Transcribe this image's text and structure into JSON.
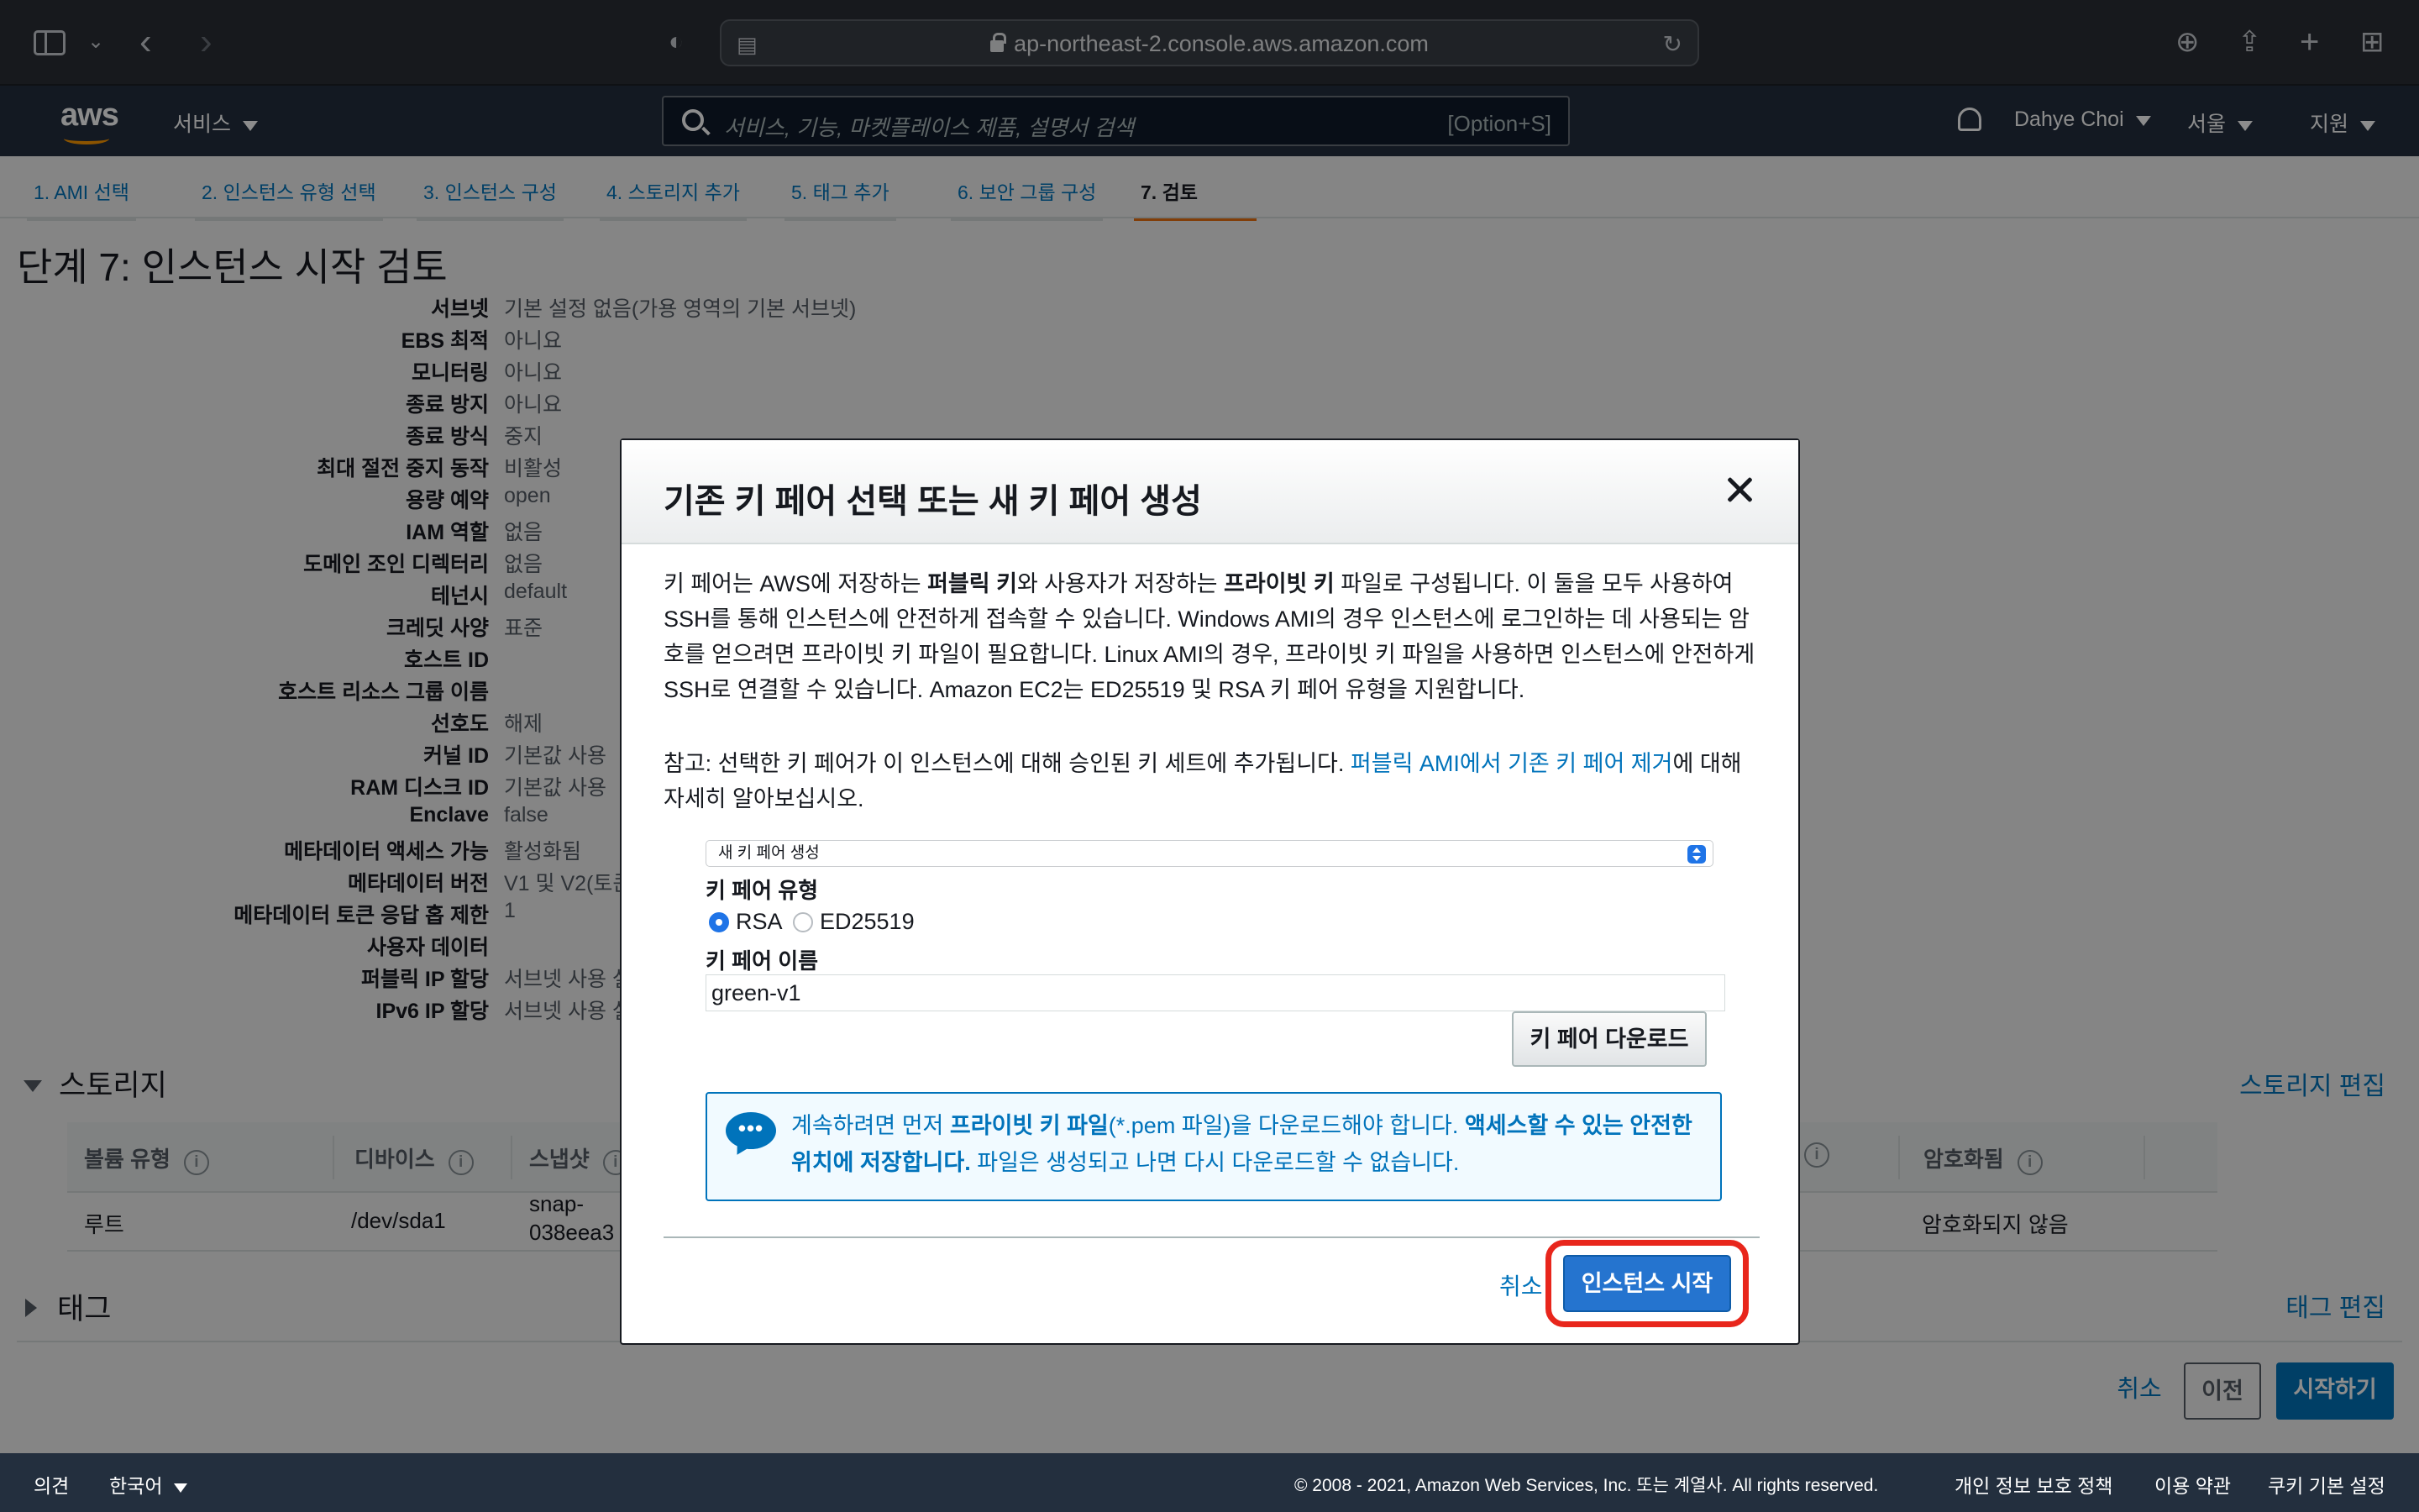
{
  "browser": {
    "url": "ap-northeast-2.console.aws.amazon.com"
  },
  "aws_nav": {
    "logo": "aws",
    "services": "서비스",
    "search_placeholder": "서비스, 기능, 마켓플레이스 제품, 설명서 검색",
    "search_shortcut": "[Option+S]",
    "user": "Dahye Choi",
    "region": "서울",
    "support": "지원"
  },
  "wizard_tabs": [
    {
      "label": "1. AMI 선택"
    },
    {
      "label": "2. 인스턴스 유형 선택"
    },
    {
      "label": "3. 인스턴스 구성"
    },
    {
      "label": "4. 스토리지 추가"
    },
    {
      "label": "5. 태그 추가"
    },
    {
      "label": "6. 보안 그룹 구성"
    },
    {
      "label": "7. 검토"
    }
  ],
  "page_title": "단계 7: 인스턴스 시작 검토",
  "details": [
    {
      "label": "서브넷",
      "value": "기본 설정 없음(가용 영역의 기본 서브넷)"
    },
    {
      "label": "EBS 최적",
      "value": "아니요"
    },
    {
      "label": "모니터링",
      "value": "아니요"
    },
    {
      "label": "종료 방지",
      "value": "아니요"
    },
    {
      "label": "종료 방식",
      "value": "중지"
    },
    {
      "label": "최대 절전 중지 동작",
      "value": "비활성"
    },
    {
      "label": "용량 예약",
      "value": "open"
    },
    {
      "label": "IAM 역할",
      "value": "없음"
    },
    {
      "label": "도메인 조인 디렉터리",
      "value": "없음"
    },
    {
      "label": "테넌시",
      "value": "default"
    },
    {
      "label": "크레딧 사양",
      "value": "표준"
    },
    {
      "label": "호스트 ID",
      "value": ""
    },
    {
      "label": "호스트 리소스 그룹 이름",
      "value": ""
    },
    {
      "label": "선호도",
      "value": "해제"
    },
    {
      "label": "커널 ID",
      "value": "기본값 사용"
    },
    {
      "label": "RAM 디스크 ID",
      "value": "기본값 사용"
    },
    {
      "label": "Enclave",
      "value": "false"
    },
    {
      "label": "메타데이터 액세스 가능",
      "value": "활성화됨"
    },
    {
      "label": "메타데이터 버전",
      "value": "V1 및 V2(토큰"
    },
    {
      "label": "메타데이터 토큰 응답 홉 제한",
      "value": "1"
    },
    {
      "label": "사용자 데이터",
      "value": ""
    },
    {
      "label": "퍼블릭 IP 할당",
      "value": "서브넷 사용 설"
    },
    {
      "label": "IPv6 IP 할당",
      "value": "서브넷 사용 설"
    }
  ],
  "storage": {
    "title": "스토리지",
    "edit": "스토리지 편집",
    "headers": [
      "볼륨 유형",
      "디바이스",
      "스냅샷",
      "암호화됨"
    ],
    "row": {
      "type": "루트",
      "device": "/dev/sda1",
      "snapshot_line1": "snap-",
      "snapshot_line2": "038eea3",
      "encrypted": "암호화되지 않음"
    }
  },
  "tags": {
    "title": "태그",
    "edit": "태그 편집"
  },
  "bottom_buttons": {
    "cancel": "취소",
    "previous": "이전",
    "launch": "시작하기"
  },
  "footer": {
    "feedback": "의견",
    "language": "한국어",
    "copyright": "© 2008 - 2021, Amazon Web Services, Inc. 또는 계열사. All rights reserved.",
    "privacy": "개인 정보 보호 정책",
    "terms": "이용 약관",
    "cookies": "쿠키 기본 설정"
  },
  "modal": {
    "title": "기존 키 페어 선택 또는 새 키 페어 생성",
    "para1": {
      "t1": "키 페어는 AWS에 저장하는 ",
      "b1": "퍼블릭 키",
      "t2": "와 사용자가 저장하는 ",
      "b2": "프라이빗 키",
      "t3": " 파일로 구성됩니다. 이 둘을 모두 사용하여 SSH를 통해 인스턴스에 안전하게 접속할 수 있습니다. Windows AMI의 경우 인스턴스에 로그인하는 데 사용되는 암호를 얻으려면 프라이빗 키 파일이 필요합니다. Linux AMI의 경우, 프라이빗 키 파일을 사용하면 인스턴스에 안전하게 SSH로 연결할 수 있습니다. Amazon EC2는 ED25519 및 RSA 키 페어 유형을 지원합니다."
    },
    "para2": {
      "t1": "참고: 선택한 키 페어가 이 인스턴스에 대해 승인된 키 세트에 추가됩니다. ",
      "link": "퍼블릭 AMI에서 기존 키 페어 제거",
      "t2": "에 대해 자세히 알아보십시오."
    },
    "select_value": "새 키 페어 생성",
    "key_type_label": "키 페어 유형",
    "key_type_options": [
      "RSA",
      "ED25519"
    ],
    "key_type_selected": "RSA",
    "key_name_label": "키 페어 이름",
    "key_name_value": "green-v1",
    "download_button": "키 페어 다운로드",
    "info": {
      "t1": "계속하려면 먼저 ",
      "b1": "프라이빗 키 파일",
      "t2": "(*.pem 파일)을 다운로드해야 합니다. ",
      "b2": "액세스할 수 있는 안전한 위치에 저장합니다.",
      "t3": " 파일은 생성되고 나면 다시 다운로드할 수 없습니다."
    },
    "cancel": "취소",
    "launch": "인스턴스 시작"
  },
  "colors": {
    "aws_nav": "#232f3e",
    "aws_orange": "#ff9900",
    "link_blue": "#0073bb",
    "primary_button": "#2574cf",
    "highlight": "#e8261c"
  }
}
